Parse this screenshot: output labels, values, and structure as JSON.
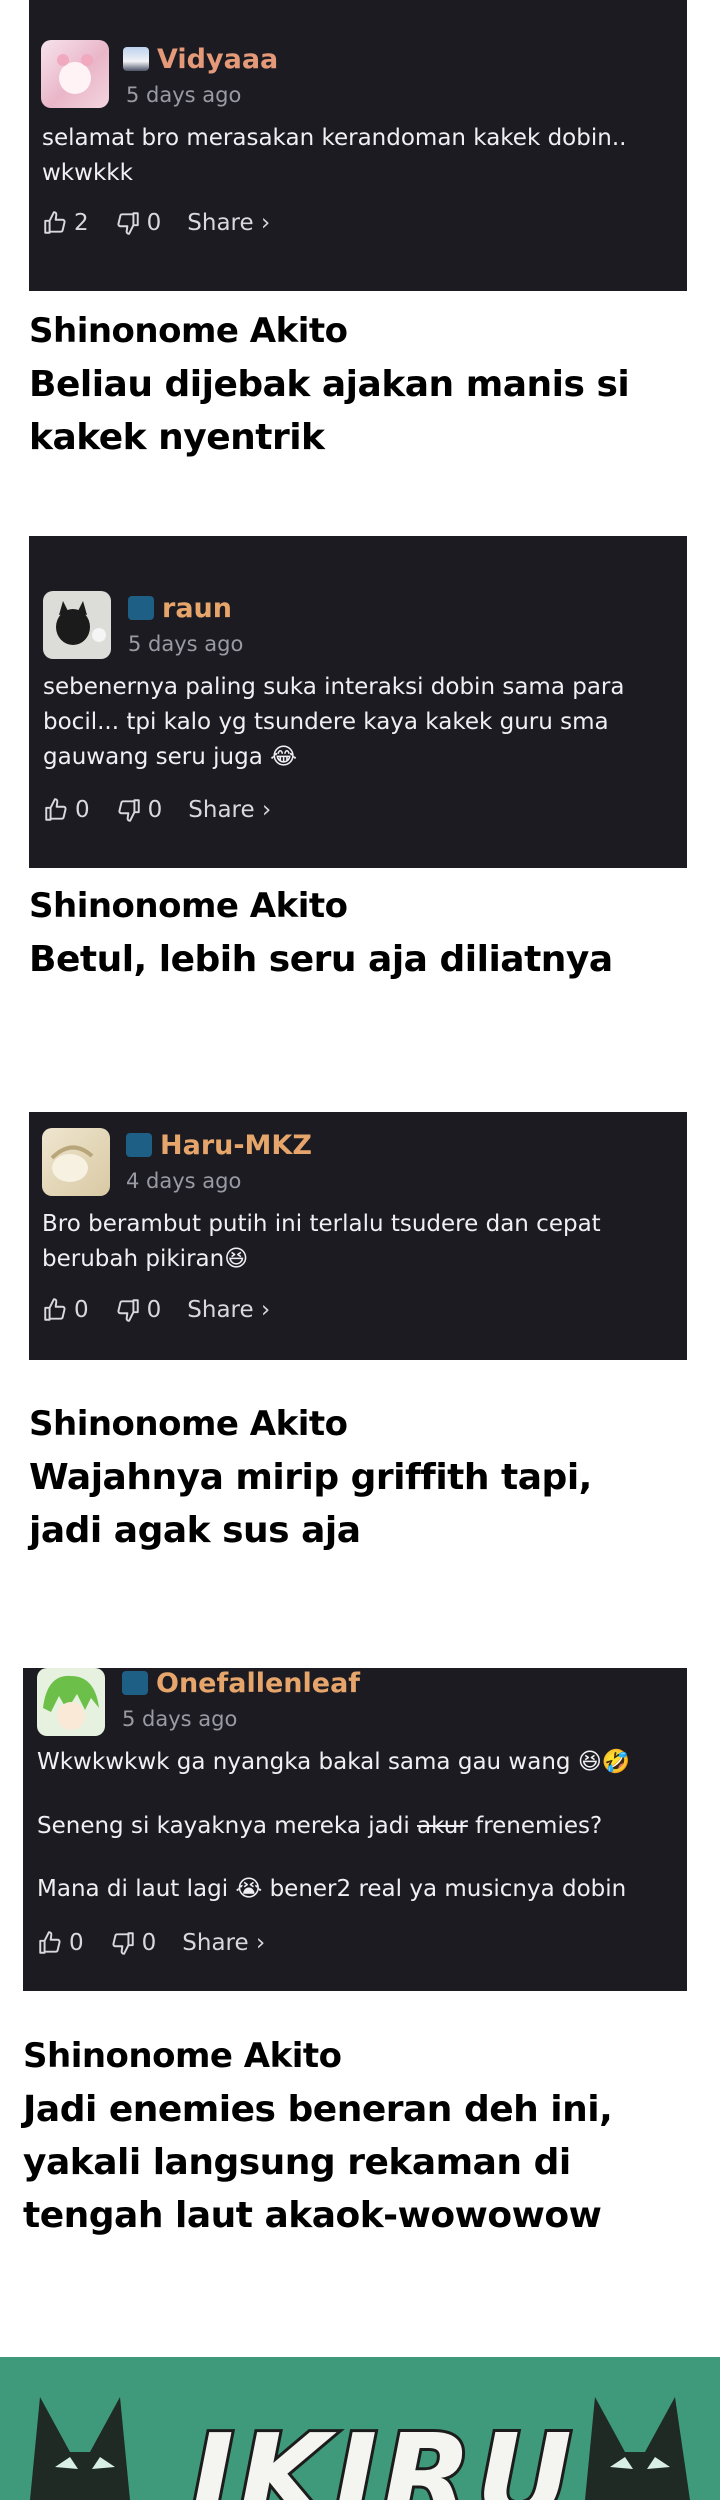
{
  "comments": [
    {
      "username": "Vidyaaa",
      "time": "5 days ago",
      "body": [
        "selamat bro merasakan kerandoman kakek dobin.. wkwkkk"
      ],
      "likes": "2",
      "dislikes": "0",
      "share": "Share ›",
      "colors": {
        "username": "#e49a78"
      }
    },
    {
      "username": "raun",
      "time": "5 days ago",
      "body": [
        "sebenernya paling suka interaksi dobin sama para bocil... tpi kalo yg tsundere kaya kakek guru sma gauwang seru juga 😂"
      ],
      "likes": "0",
      "dislikes": "0",
      "share": "Share ›",
      "colors": {
        "username": "#e6a56a"
      }
    },
    {
      "username": "Haru-MKZ",
      "time": "4 days ago",
      "body": [
        "Bro berambut putih ini terlalu tsudere dan cepat berubah pikiran😆"
      ],
      "likes": "0",
      "dislikes": "0",
      "share": "Share ›",
      "colors": {
        "username": "#e6a56a"
      }
    },
    {
      "username": "Onefallenleaf",
      "time": "5 days ago",
      "body_line1": "Wkwkwkwk ga nyangka bakal sama gau wang 😆🤣",
      "body_line2_pre": "Seneng si kayaknya mereka jadi ",
      "body_line2_strike": "akur",
      "body_line2_post": " frenemies?",
      "body_line3": "Mana di laut lagi 😭 bener2 real ya musicnya dobin",
      "likes": "0",
      "dislikes": "0",
      "share": "Share ›",
      "colors": {
        "username": "#e6a56a"
      }
    }
  ],
  "replies": [
    {
      "name": "Shinonome Akito",
      "text": "Beliau dijebak ajakan manis si kakek nyentrik"
    },
    {
      "name": "Shinonome Akito",
      "text": "Betul, lebih seru aja diliatnya"
    },
    {
      "name": "Shinonome Akito",
      "text": "Wajahnya mirip griffith tapi, jadi agak sus aja"
    },
    {
      "name": "Shinonome Akito",
      "text": "Jadi enemies beneran deh ini, yakali langsung rekaman di tengah laut akaok-wowowow"
    }
  ],
  "banner": {
    "title": "IKIRU",
    "color": "#3f9a7c"
  },
  "icons": {
    "like": "thumbs-up-icon",
    "dislike": "thumbs-down-icon"
  }
}
